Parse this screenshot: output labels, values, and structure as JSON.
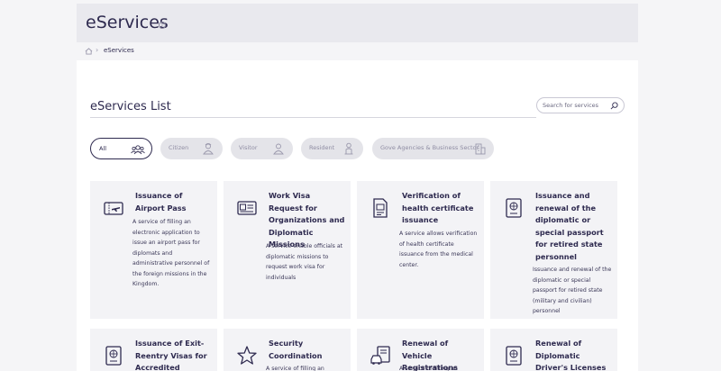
{
  "header": {
    "title": "eServices"
  },
  "breadcrumb": {
    "current": "eServices"
  },
  "section": {
    "title": "eServices List"
  },
  "search": {
    "placeholder": "Search for services"
  },
  "filters": [
    {
      "label": "All",
      "active": true,
      "icon": "group-icon"
    },
    {
      "label": "Citizen",
      "active": false,
      "icon": "citizen-icon"
    },
    {
      "label": "Visitor",
      "active": false,
      "icon": "visitor-icon"
    },
    {
      "label": "Resident",
      "active": false,
      "icon": "resident-icon"
    },
    {
      "label": "Gove Agencies & Business Sector",
      "active": false,
      "icon": "building-icon"
    }
  ],
  "cards": [
    {
      "title": "Issuance of Airport Pass",
      "description": "A service of filling an electronic application to issue an airport pass for diplomats and administrative personnel of the foreign missions in the Kingdom.",
      "icon": "ticket-plane-icon"
    },
    {
      "title": "Work Visa Request for Organizations and Diplomatic Missions",
      "description": "A service enable officials at diplomatic missions to request work visa for individuals",
      "icon": "id-card-icon"
    },
    {
      "title": "Verification of health certificate issuance",
      "description": "A service allows verification of health certificate issuance from the medical center.",
      "icon": "certificate-icon"
    },
    {
      "title": "Issuance and renewal of the diplomatic or special passport for retired state personnel",
      "description": "Issuance and renewal of the diplomatic or special passport for retired state (military and civilian) personnel",
      "icon": "passport-icon"
    },
    {
      "title": "Issuance of Exit-Reentry Visas for Accredited",
      "description": "",
      "icon": "passport-icon"
    },
    {
      "title": "Security Coordination",
      "description": "A service of filling an",
      "icon": "star-icon"
    },
    {
      "title": "Renewal of Vehicle Registrations",
      "description": "A service of filling an",
      "icon": "vehicle-document-icon"
    },
    {
      "title": "Renewal of Diplomatic Driver's Licenses",
      "description": "",
      "icon": "passport-icon"
    }
  ],
  "colors": {
    "primary": "#2e2a4f",
    "card_bg": "#f3f3f6",
    "page_bg": "#f5f5f7"
  }
}
